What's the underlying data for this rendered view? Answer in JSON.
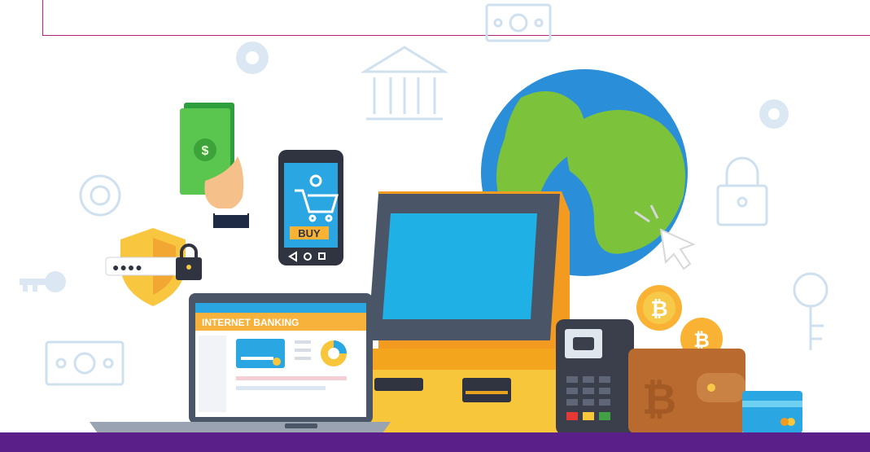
{
  "banner": {
    "screen_heading": "INTERNET BANKING",
    "phone_button": "BUY",
    "password_mask": "●●●●",
    "accent_color": "#5b1f8a",
    "frame_color": "#b0257e"
  },
  "icons": [
    "money-bill-icon",
    "gear-icon",
    "bank-icon",
    "lock-icon",
    "key-icon",
    "globe-icon",
    "cursor-icon",
    "bitcoin-icon",
    "shield-icon",
    "cart-icon",
    "padlock-icon",
    "card-icon",
    "wallet-icon"
  ]
}
